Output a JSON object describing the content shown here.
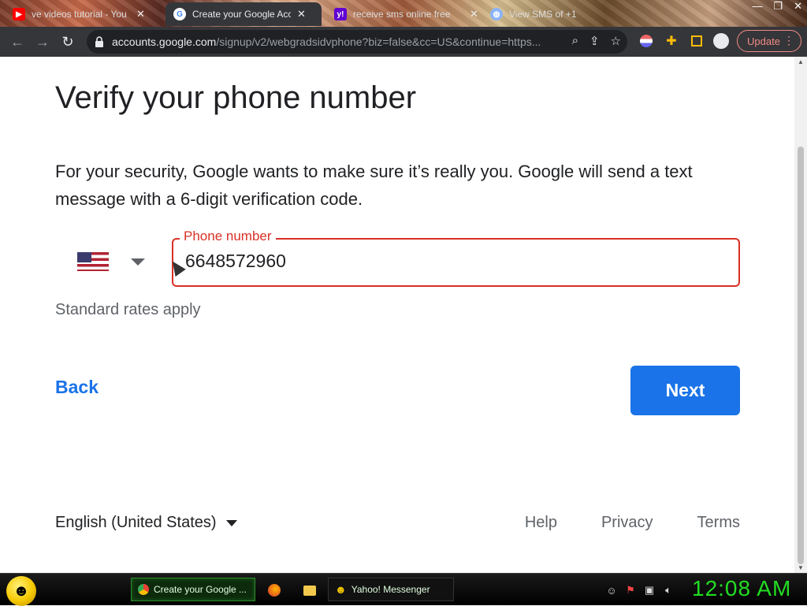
{
  "browser": {
    "tabs": [
      {
        "title": "ve videos tutorial - You",
        "favicon": "youtube-icon",
        "active": false
      },
      {
        "title": "Create your Google Acco",
        "favicon": "google-icon",
        "active": true
      },
      {
        "title": "receive sms online free",
        "favicon": "yahoo-icon",
        "active": false
      },
      {
        "title": "View SMS of +1",
        "favicon": "globe-icon",
        "active": false
      }
    ],
    "url_host": "accounts.google.com",
    "url_path": "/signup/v2/webgradsidvphone?biz=false&cc=US&continue=https...",
    "update_label": "Update"
  },
  "page": {
    "title": "Verify your phone number",
    "description": "For your security, Google wants to make sure it’s really you. Google will send a text message with a 6-digit verification code.",
    "country": "United States",
    "phone_label": "Phone number",
    "phone_value": "6648572960",
    "rates_note": "Standard rates apply",
    "back_label": "Back",
    "next_label": "Next",
    "language": "English (United States)",
    "footer_links": [
      "Help",
      "Privacy",
      "Terms"
    ]
  },
  "taskbar": {
    "items": [
      {
        "label": "Create your Google ...",
        "icon": "chrome-icon",
        "active": true
      },
      {
        "label": "Yahoo! Messenger",
        "icon": "yahoo-messenger-icon",
        "active": false
      }
    ],
    "clock": "12:08 AM"
  },
  "colors": {
    "accent_blue": "#1a73e8",
    "error_red": "#d93025",
    "clock_green": "#22dd22"
  }
}
